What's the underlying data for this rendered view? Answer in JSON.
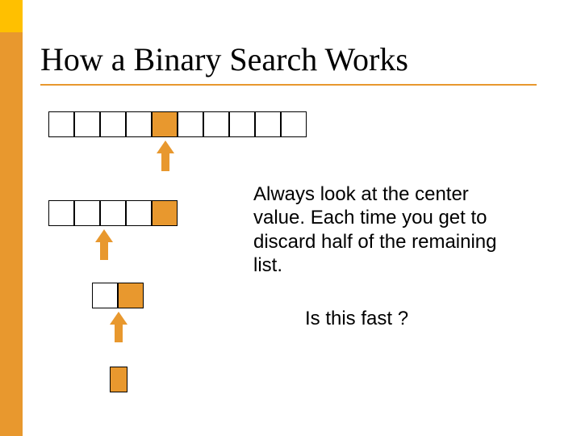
{
  "title": "How a Binary Search Works",
  "paragraph": "Always look at the center value.  Each time you get to discard half of the remaining list.",
  "question": "Is this fast ?",
  "arrays": {
    "row1": {
      "length": 10,
      "highlight_index": 4
    },
    "row2": {
      "length": 5,
      "highlight_index": 4
    },
    "row3": {
      "length": 2,
      "highlight_index": 1
    }
  },
  "colors": {
    "accent": "#e8982e",
    "accent_light": "#ffc000"
  }
}
